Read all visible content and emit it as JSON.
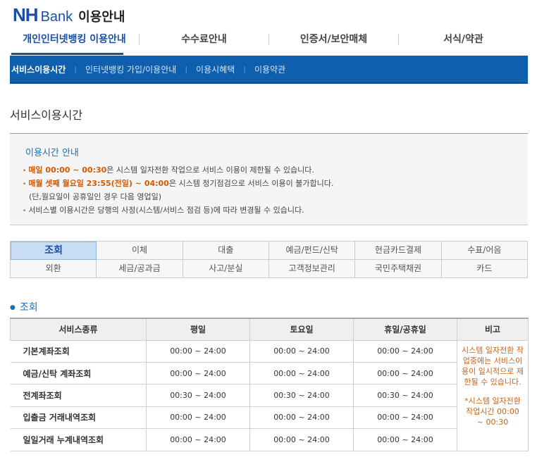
{
  "header": {
    "logo_nh": "NH",
    "logo_bank": "Bank",
    "title": "이용안내"
  },
  "gnb": [
    {
      "label": "개인인터넷뱅킹 이용안내",
      "active": true
    },
    {
      "label": "수수료안내",
      "active": false
    },
    {
      "label": "인증서/보안매체",
      "active": false
    },
    {
      "label": "서식/약관",
      "active": false
    }
  ],
  "subnav": [
    {
      "label": "서비스이용시간",
      "active": true
    },
    {
      "label": "인터넷뱅킹 가입/이용안내",
      "active": false
    },
    {
      "label": "이용시혜택",
      "active": false
    },
    {
      "label": "이용약관",
      "active": false
    }
  ],
  "page_title": "서비스이용시간",
  "notice": {
    "heading": "이용시간 안내",
    "items": [
      {
        "highlight": "매일 00:00 ~ 00:30",
        "text": "은 시스템 일자전환 작업으로 서비스 이용이 제한될 수 있습니다."
      },
      {
        "highlight": "매월 셋째 월요일 23:55(전일) ~ 04:00",
        "text": "은 시스템 정기점검으로 서비스 이용이 불가합니다."
      },
      {
        "highlight": "",
        "text": "(단,월요일이 공휴일인 경우 다음 영업일)",
        "indent": true
      },
      {
        "highlight": "",
        "text": "서비스별 이용시간은 당행의 사정(시스템/서비스 점검 등)에 따라 변경될 수 있습니다."
      }
    ]
  },
  "categories": [
    "조회",
    "이체",
    "대출",
    "예금/펀드/신탁",
    "현금카드결제",
    "수표/어음",
    "외환",
    "세금/공과금",
    "사고/분실",
    "고객정보관리",
    "국민주택채권",
    "카드"
  ],
  "section_heading": "조회",
  "table": {
    "headers": [
      "서비스종류",
      "평일",
      "토요일",
      "휴일/공휴일",
      "비고"
    ],
    "rows": [
      {
        "name": "기본계좌조회",
        "weekday": "00:00 ~ 24:00",
        "saturday": "00:00 ~ 24:00",
        "holiday": "00:00 ~ 24:00"
      },
      {
        "name": "예금/신탁 계좌조회",
        "weekday": "00:00 ~ 24:00",
        "saturday": "00:00 ~ 24:00",
        "holiday": "00:00 ~ 24:00"
      },
      {
        "name": "전계좌조회",
        "weekday": "00:30 ~ 24:00",
        "saturday": "00:30 ~ 24:00",
        "holiday": "00:30 ~ 24:00"
      },
      {
        "name": "입출금 거래내역조회",
        "weekday": "00:00 ~ 24:00",
        "saturday": "00:00 ~ 24:00",
        "holiday": "00:00 ~ 24:00"
      },
      {
        "name": "일일거래 누계내역조회",
        "weekday": "00:00 ~ 24:00",
        "saturday": "00:00 ~ 24:00",
        "holiday": "00:00 ~ 24:00"
      }
    ],
    "note_1": "시스템 일자전환 작업중에는 서비스이용이 일시적으로 제한될 수 있습니다.",
    "note_2": "*시스템 일자전환 작업시간 00:00 ~ 00:30"
  },
  "colors": {
    "brand_blue": "#1a4fa3",
    "subnav_bg": "#0e5fad",
    "highlight_orange": "#d35a00",
    "active_tab_bg": "#c8ddf3"
  }
}
